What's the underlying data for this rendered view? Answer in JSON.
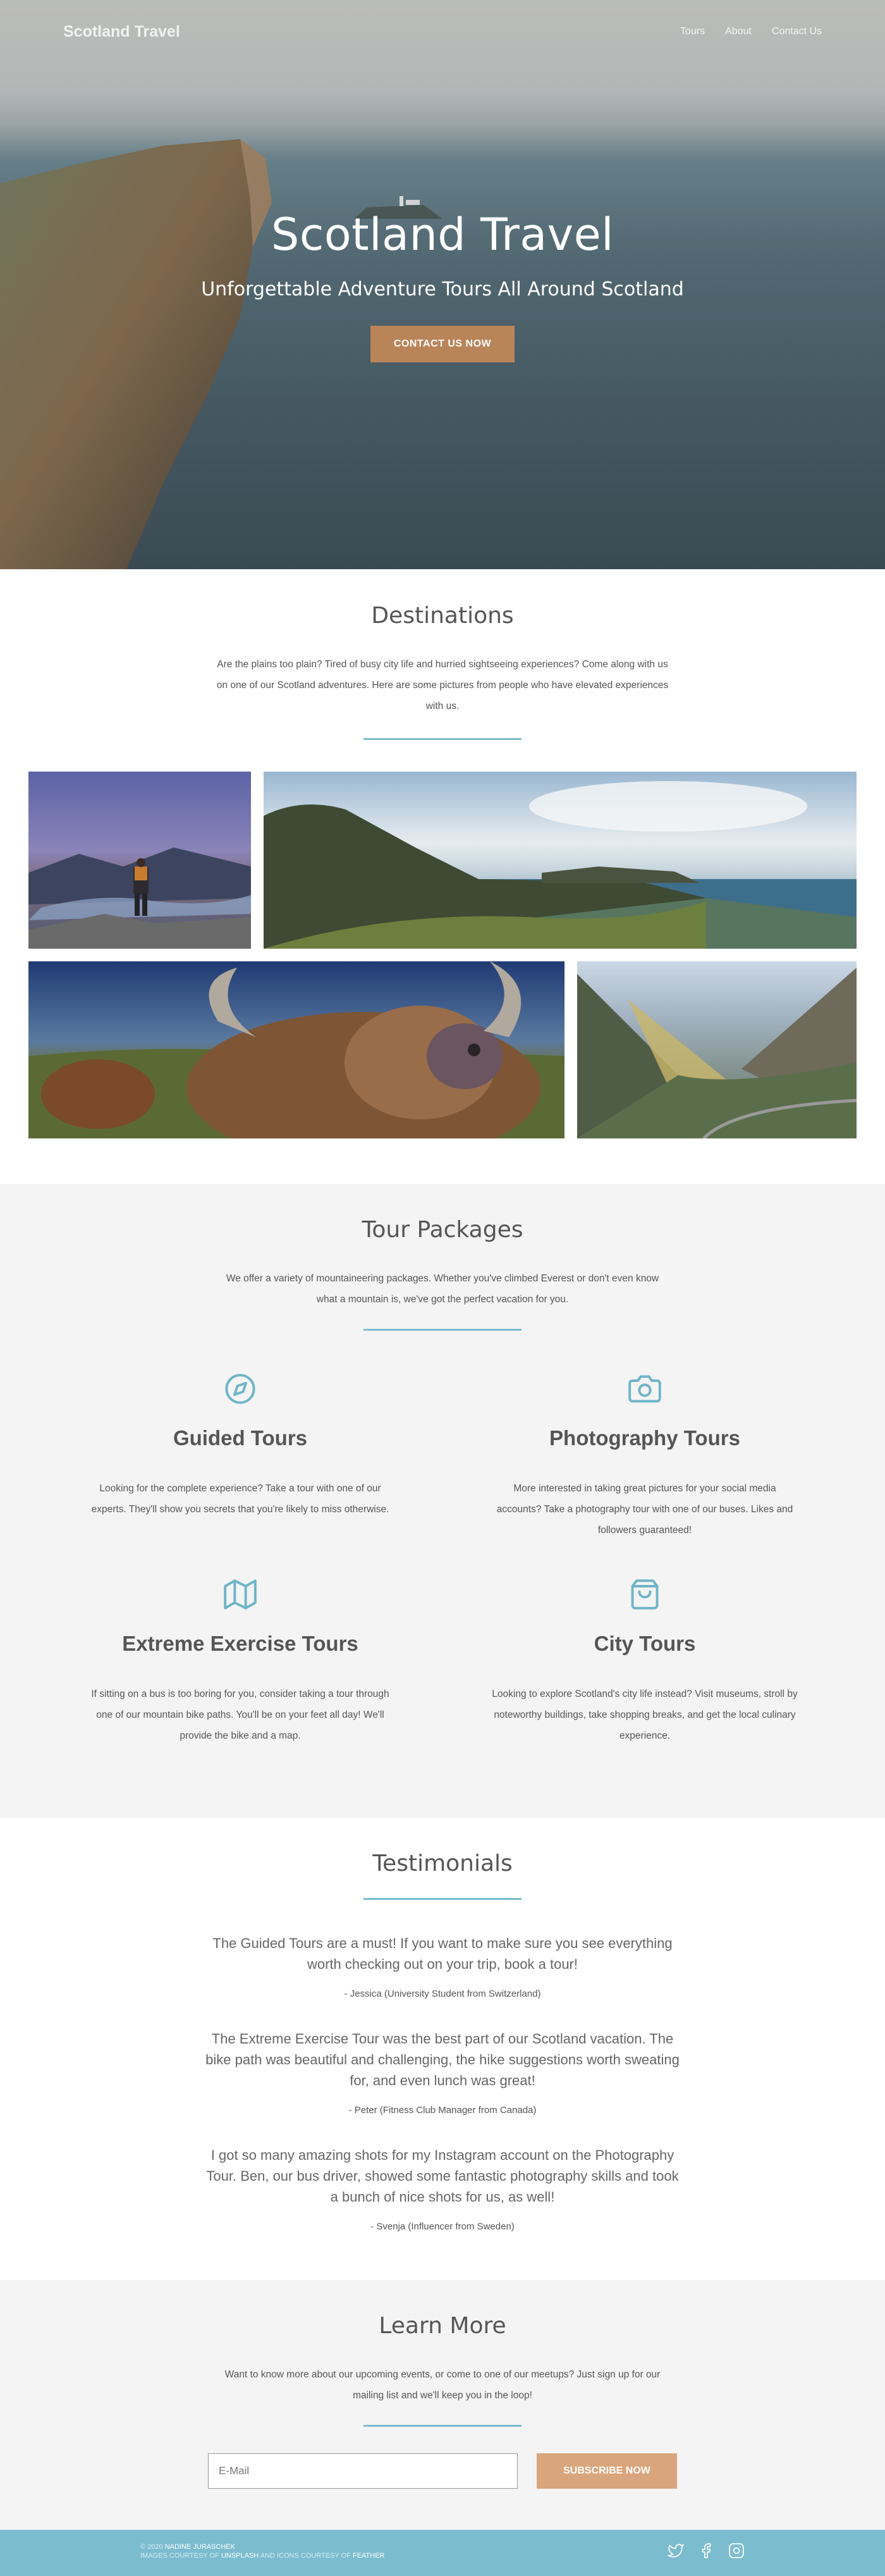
{
  "nav": {
    "brand": "Scotland Travel",
    "links": [
      "Tours",
      "About",
      "Contact Us"
    ]
  },
  "hero": {
    "title": "Scotland Travel",
    "subtitle": "Unforgettable Adventure Tours All Around Scotland",
    "cta": "CONTACT US NOW"
  },
  "destinations": {
    "title": "Destinations",
    "intro": "Are the plains too plain? Tired of busy city life and hurried sightseeing experiences? Come along with us on one of our Scotland adventures. Here are some pictures from people who have elevated experiences with us."
  },
  "tours": {
    "title": "Tour Packages",
    "intro": "We offer a variety of mountaineering packages. Whether you've climbed Everest or don't even know what a mountain is, we've got the perfect vacation for you.",
    "items": [
      {
        "icon": "compass-icon",
        "title": "Guided Tours",
        "text": "Looking for the complete experience? Take a tour with one of our experts. They'll show you secrets that you're likely to miss otherwise."
      },
      {
        "icon": "camera-icon",
        "title": "Photography Tours",
        "text": "More interested in taking great pictures for your social media accounts? Take a photography tour with one of our buses. Likes and followers guaranteed!"
      },
      {
        "icon": "map-icon",
        "title": "Extreme Exercise Tours",
        "text": "If sitting on a bus is too boring for you, consider taking a tour through one of our mountain bike paths. You'll be on your feet all day! We'll provide the bike and a map."
      },
      {
        "icon": "shopping-bag-icon",
        "title": "City Tours",
        "text": "Looking to explore Scotland's city life instead? Visit museums, stroll by noteworthy buildings, take shopping breaks, and get the local culinary experience."
      }
    ]
  },
  "testimonials": {
    "title": "Testimonials",
    "items": [
      {
        "quote": "The Guided Tours are a must! If you want to make sure you see everything worth checking out on your trip, book a tour!",
        "author": "- Jessica (University Student from Switzerland)"
      },
      {
        "quote": "The Extreme Exercise Tour was the best part of our Scotland vacation. The bike path was beautiful and challenging, the hike suggestions worth sweating for, and even lunch was great!",
        "author": "- Peter (Fitness Club Manager from Canada)"
      },
      {
        "quote": "I got so many amazing shots for my Instagram account on the Photography Tour. Ben, our bus driver, showed some fantastic photography skills and took a bunch of nice shots for us, as well!",
        "author": "- Svenja (Influencer from Sweden)"
      }
    ]
  },
  "learn": {
    "title": "Learn More",
    "intro": "Want to know more about our upcoming events, or come to one of our meetups? Just sign up for our mailing list and we'll keep you in the loop!",
    "email_placeholder": "E-Mail",
    "submit": "SUBSCRIBE NOW"
  },
  "footer": {
    "copyright_prefix": "© 2020 ",
    "copyright_name": "NADINE JURASCHEK",
    "images_prefix": "IMAGES COURTESY OF ",
    "images_source": "UNSPLASH",
    "icons_prefix": " AND ICONS COURTESY OF ",
    "icons_source": "FEATHER",
    "social": [
      "twitter-icon",
      "facebook-icon",
      "instagram-icon"
    ]
  },
  "colors": {
    "accent": "#7bbccf",
    "button_brown": "#b98458",
    "button_tan": "#d9a57c",
    "section_grey": "#f4f4f4"
  }
}
